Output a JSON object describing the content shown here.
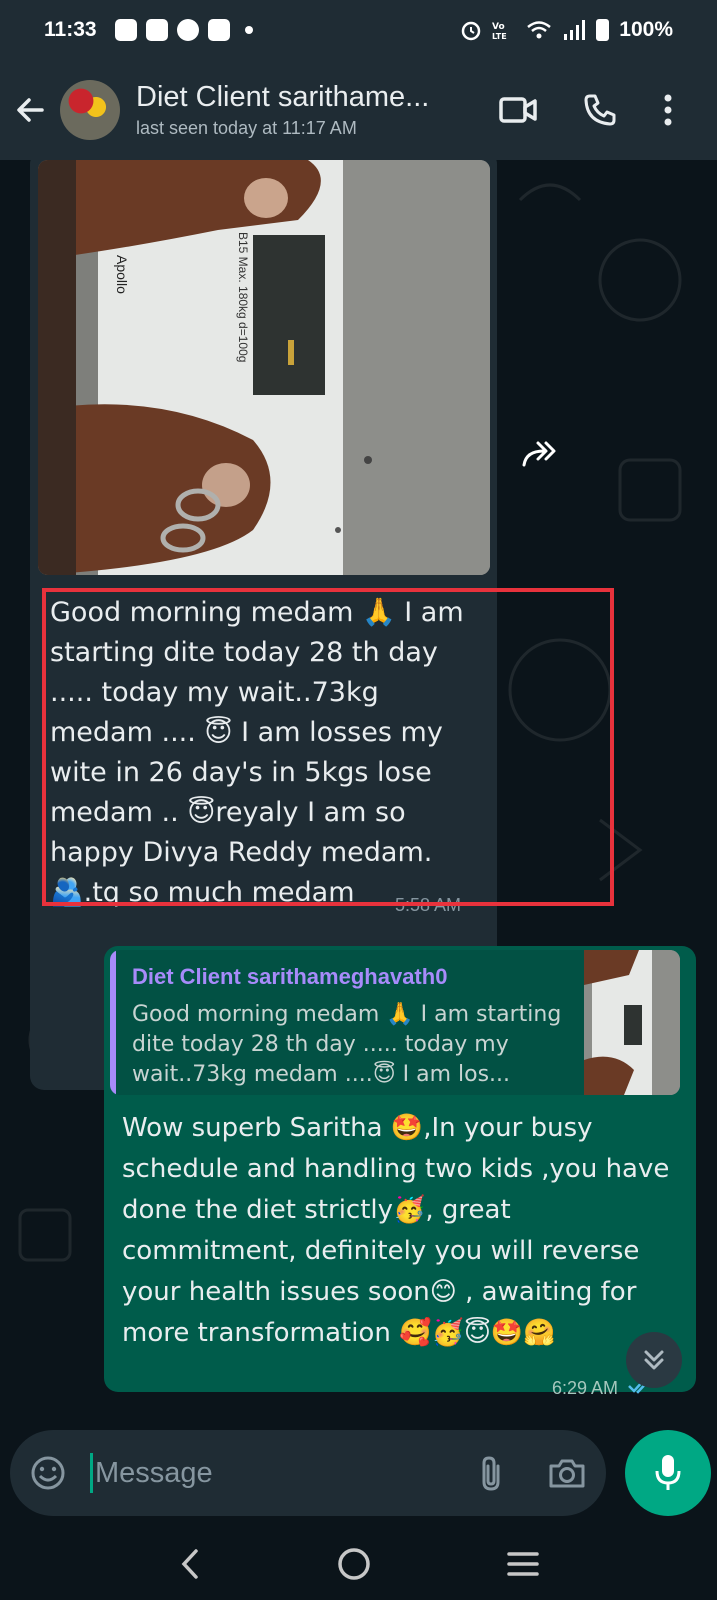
{
  "status_bar": {
    "time": "11:33",
    "battery": "100%"
  },
  "header": {
    "contact_name": "Diet Client sarithame...",
    "last_seen": "last seen today at 11:17 AM"
  },
  "messages": {
    "incoming": {
      "photo_scale_brand": "Apollo",
      "photo_scale_spec": "B15 Max. 180kg d=100g",
      "text": "Good morning medam 🙏 I am starting dite today 28 th day ..... today my wait..73kg medam .... 😇 I am losses my wite in 26 day's in 5kgs lose medam .. 😇reyaly I am so happy Divya Reddy medam.🫂.tq so much medam",
      "time": "5:58 AM"
    },
    "outgoing": {
      "quoted_author": "Diet Client sarithameghavath0",
      "quoted_text": "Good morning medam 🙏 I am starting dite today 28 th day ..... today my wait..73kg medam ....😇 I am los...",
      "text": "Wow superb Saritha 🤩,In your busy schedule and handling two kids ,you have done the diet strictly🥳, great commitment, definitely you will reverse your health issues soon😊 , awaiting for more transformation 🥰🥳😇🤩🤗",
      "time": "6:29 AM"
    }
  },
  "composer": {
    "placeholder": "Message"
  },
  "colors": {
    "header_bg": "#1f2c34",
    "chat_bg": "#0b141a",
    "incoming_bubble": "#1f2c34",
    "outgoing_bubble": "#005c4b",
    "accent": "#00a884",
    "highlight_border": "#e8323c",
    "quote_author": "#a78bfa"
  },
  "icons": {
    "back": "arrow-left-icon",
    "video": "video-camera-icon",
    "call": "phone-icon",
    "menu": "kebab-menu-icon",
    "forward": "forward-icon",
    "emoji": "smiley-icon",
    "attach": "paperclip-icon",
    "camera": "camera-icon",
    "mic": "microphone-icon",
    "scroll_down": "double-chevron-down-icon"
  }
}
